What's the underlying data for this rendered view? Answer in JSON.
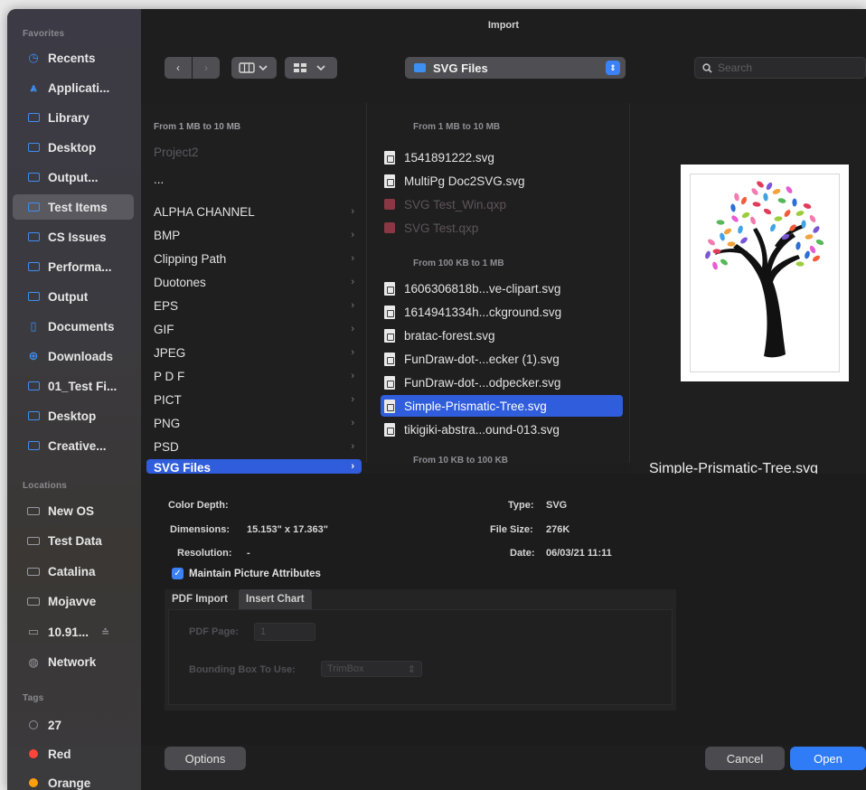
{
  "window": {
    "title": "Import"
  },
  "sidebar": {
    "favorites_header": "Favorites",
    "favorites": [
      {
        "label": "Recents",
        "icon": "clock-icon"
      },
      {
        "label": "Applicati...",
        "icon": "applications-icon"
      },
      {
        "label": "Library",
        "icon": "folder-icon"
      },
      {
        "label": "Desktop",
        "icon": "desktop-icon"
      },
      {
        "label": "Output...",
        "icon": "folder-icon"
      },
      {
        "label": "Test Items",
        "icon": "folder-icon",
        "selected": true
      },
      {
        "label": "CS Issues",
        "icon": "folder-icon"
      },
      {
        "label": "Performa...",
        "icon": "folder-icon"
      },
      {
        "label": "Output",
        "icon": "folder-icon"
      },
      {
        "label": "Documents",
        "icon": "document-icon"
      },
      {
        "label": "Downloads",
        "icon": "download-icon"
      },
      {
        "label": "01_Test Fi...",
        "icon": "folder-icon"
      },
      {
        "label": "Desktop",
        "icon": "folder-icon"
      },
      {
        "label": "Creative...",
        "icon": "folder-icon"
      }
    ],
    "locations_header": "Locations",
    "locations": [
      {
        "label": "New OS",
        "icon": "disk-icon"
      },
      {
        "label": "Test Data",
        "icon": "disk-icon"
      },
      {
        "label": "Catalina",
        "icon": "disk-icon"
      },
      {
        "label": "Mojavve",
        "icon": "disk-icon"
      },
      {
        "label": "10.91...",
        "icon": "computer-icon",
        "eject": "≐"
      },
      {
        "label": "Network",
        "icon": "network-icon"
      }
    ],
    "tags_header": "Tags",
    "tags": [
      {
        "label": "27",
        "color": "#8e8e93",
        "hollow": true
      },
      {
        "label": "Red",
        "color": "#ff453a"
      },
      {
        "label": "Orange",
        "color": "#ff9f0a"
      }
    ]
  },
  "toolbar": {
    "back_icon": "‹",
    "forward_icon": "›",
    "location": "SVG Files",
    "search_placeholder": "Search"
  },
  "column1": {
    "header": "From 1 MB to 10 MB",
    "items": [
      {
        "label": "Project2",
        "dim": true
      },
      {
        "label": "...",
        "dim": false,
        "noarrow": true
      },
      {
        "label": "ALPHA CHANNEL"
      },
      {
        "label": "BMP"
      },
      {
        "label": "Clipping Path"
      },
      {
        "label": "Duotones"
      },
      {
        "label": "EPS"
      },
      {
        "label": "GIF"
      },
      {
        "label": "JPEG"
      },
      {
        "label": "P D F"
      },
      {
        "label": "PICT"
      },
      {
        "label": "PNG"
      },
      {
        "label": "PSD"
      },
      {
        "label": "SVG Files",
        "selected": true
      }
    ]
  },
  "column2": {
    "header": "From 1 MB to 10 MB",
    "group1": [
      {
        "label": "1541891222.svg",
        "type": "svg"
      },
      {
        "label": "MultiPg Doc2SVG.svg",
        "type": "svg"
      },
      {
        "label": "SVG Test_Win.qxp",
        "type": "qxp",
        "dim": true
      },
      {
        "label": "SVG Test.qxp",
        "type": "qxp",
        "dim": true
      }
    ],
    "header2": "From 100 KB to 1 MB",
    "group2": [
      {
        "label": "1606306818b...ve-clipart.svg",
        "type": "svg"
      },
      {
        "label": "1614941334h...ckground.svg",
        "type": "svg"
      },
      {
        "label": "bratac-forest.svg",
        "type": "svg"
      },
      {
        "label": "FunDraw-dot-...ecker (1).svg",
        "type": "svg"
      },
      {
        "label": "FunDraw-dot-...odpecker.svg",
        "type": "svg"
      },
      {
        "label": "Simple-Prismatic-Tree.svg",
        "type": "svg",
        "selected": true
      },
      {
        "label": "tikigiki-abstra...ound-013.svg",
        "type": "svg"
      }
    ],
    "header3": "From 10 KB to 100 KB"
  },
  "preview": {
    "filename": "Simple-Prismatic-Tree.svg"
  },
  "info": {
    "color_depth_label": "Color Depth:",
    "dimensions_label": "Dimensions:",
    "dimensions_value": "15.153\" x 17.363\"",
    "resolution_label": "Resolution:",
    "resolution_value": "-",
    "type_label": "Type:",
    "type_value": "SVG",
    "filesize_label": "File Size:",
    "filesize_value": "276K",
    "date_label": "Date:",
    "date_value": "06/03/21 11:11",
    "maintain_label": "Maintain Picture Attributes",
    "maintain_checked": true
  },
  "tabs": {
    "pdf_import": "PDF Import",
    "insert_chart": "Insert Chart",
    "pdf_page_label": "PDF Page:",
    "pdf_page_value": "1",
    "bbox_label": "Bounding Box To Use:",
    "bbox_value": "TrimBox"
  },
  "buttons": {
    "options": "Options",
    "cancel": "Cancel",
    "open": "Open"
  },
  "colors": {
    "accent": "#2f7cf6",
    "selection": "#2f5ddb",
    "folder": "#3d8ff2"
  }
}
